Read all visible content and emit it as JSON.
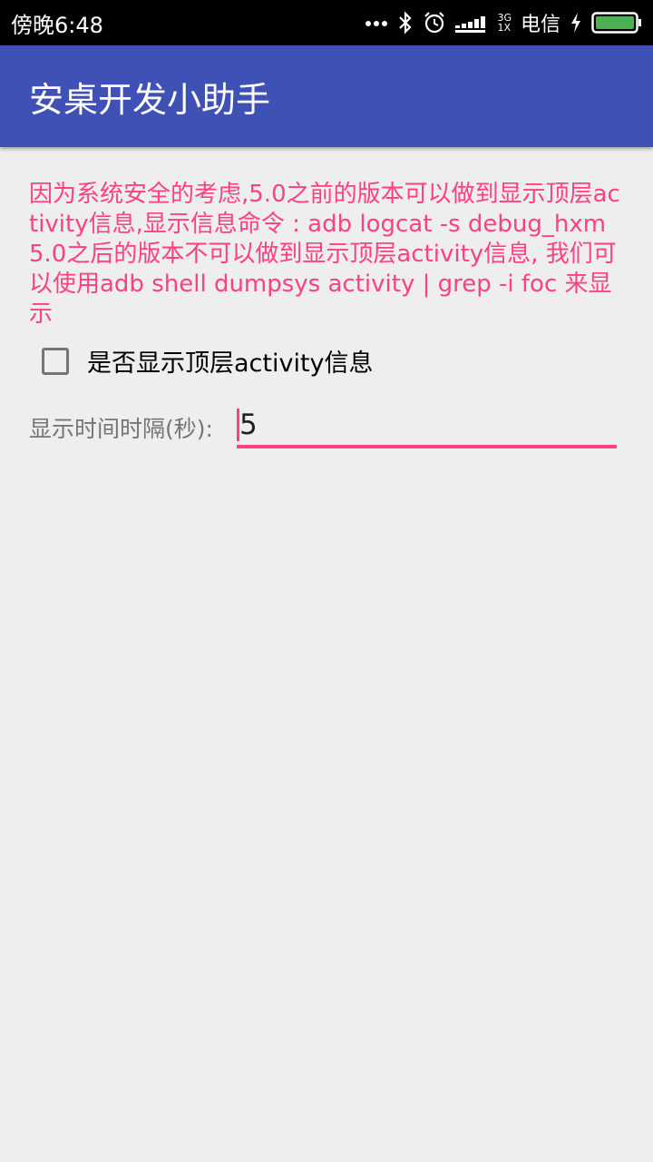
{
  "status_bar": {
    "time": "傍晚6:48",
    "network_top": "3G",
    "network_bottom": "1X",
    "carrier": "电信",
    "icons": [
      "more-dots-icon",
      "bluetooth-icon",
      "alarm-icon",
      "signal-icon",
      "charging-icon",
      "battery-icon"
    ],
    "battery_color": "#4caf50"
  },
  "app_bar": {
    "title": "安桌开发小助手",
    "color": "#3f51b5"
  },
  "main": {
    "description": "因为系统安全的考虑,5.0之前的版本可以做到显示顶层activity信息,显示信息命令 : adb logcat -s debug_hxm 5.0之后的版本不可以做到显示顶层activity信息, 我们可以使用adb shell dumpsys activity | grep -i foc 来显示",
    "description_color": "#ff4081",
    "checkbox": {
      "label": "是否显示顶层activity信息",
      "checked": false
    },
    "interval": {
      "label": "显示时间时隔(秒):",
      "value": "5"
    }
  }
}
